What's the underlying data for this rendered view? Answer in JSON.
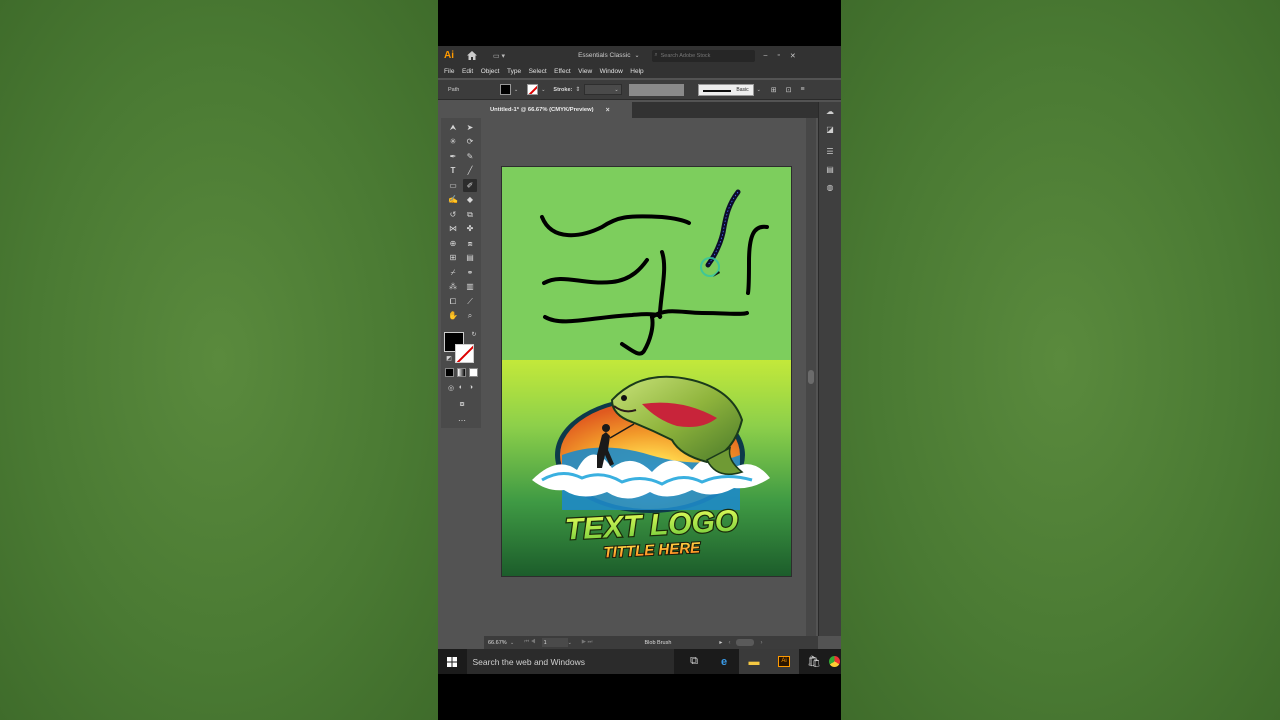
{
  "titlebar": {
    "app_logo": "Ai",
    "workspace": "Essentials Classic",
    "search_placeholder": "Search Adobe Stock"
  },
  "menu": {
    "items": [
      "File",
      "Edit",
      "Object",
      "Type",
      "Select",
      "Effect",
      "View",
      "Window",
      "Help"
    ]
  },
  "control": {
    "selection_type": "Path",
    "stroke_label": "Stroke:",
    "brush_definition": "Basic"
  },
  "document_tab": {
    "title": "Untitled-1* @ 66.67% (CMYK/Preview)",
    "close": "×"
  },
  "artboard": {
    "top_color": "#7dce5d",
    "logo": {
      "title": "TEXT LOGO",
      "subtitle": "TITTLE HERE"
    }
  },
  "statusbar": {
    "zoom": "66.67%",
    "page": "1",
    "current_tool": "Blob Brush"
  },
  "taskbar": {
    "search_placeholder": "Search the web and Windows",
    "pinned": [
      "task-view-icon",
      "edge-icon",
      "file-explorer-icon",
      "illustrator-icon",
      "store-icon",
      "chrome-icon"
    ]
  },
  "colors": {
    "accent": "#ff9a00",
    "ui_dark": "#323232",
    "ui_mid": "#535353"
  }
}
